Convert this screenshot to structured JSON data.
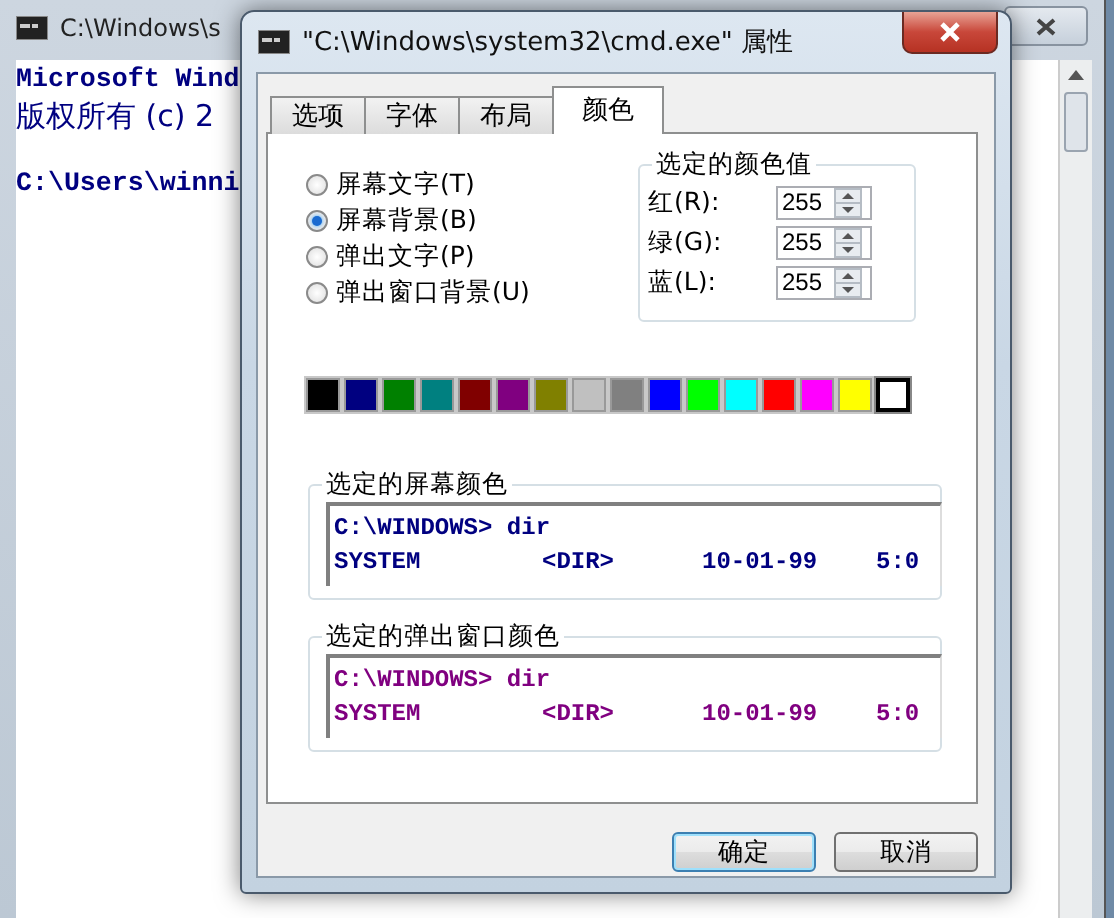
{
  "console_window": {
    "title": "C:\\Windows\\s",
    "paragraphs": [
      [
        "Microsoft Wind",
        "版权所有 (c) 2"
      ],
      [
        "C:\\Users\\winni"
      ]
    ]
  },
  "dialog": {
    "title": "\"C:\\Windows\\system32\\cmd.exe\" 属性",
    "tabs": [
      {
        "label": "选项",
        "selected": false
      },
      {
        "label": "字体",
        "selected": false
      },
      {
        "label": "布局",
        "selected": false
      },
      {
        "label": "颜色",
        "selected": true
      }
    ],
    "targets": [
      {
        "label": "屏幕文字(T)",
        "selected": false
      },
      {
        "label": "屏幕背景(B)",
        "selected": true
      },
      {
        "label": "弹出文字(P)",
        "selected": false
      },
      {
        "label": "弹出窗口背景(U)",
        "selected": false
      }
    ],
    "color_values": {
      "title": "选定的颜色值",
      "fields": [
        {
          "label": "红(R):",
          "value": "255"
        },
        {
          "label": "绿(G):",
          "value": "255"
        },
        {
          "label": "蓝(L):",
          "value": "255"
        }
      ]
    },
    "palette": [
      {
        "color": "#000000",
        "selected": false
      },
      {
        "color": "#000080",
        "selected": false
      },
      {
        "color": "#008000",
        "selected": false
      },
      {
        "color": "#008080",
        "selected": false
      },
      {
        "color": "#800000",
        "selected": false
      },
      {
        "color": "#800080",
        "selected": false
      },
      {
        "color": "#808000",
        "selected": false
      },
      {
        "color": "#c0c0c0",
        "selected": false
      },
      {
        "color": "#808080",
        "selected": false
      },
      {
        "color": "#0000ff",
        "selected": false
      },
      {
        "color": "#00ff00",
        "selected": false
      },
      {
        "color": "#00ffff",
        "selected": false
      },
      {
        "color": "#ff0000",
        "selected": false
      },
      {
        "color": "#ff00ff",
        "selected": false
      },
      {
        "color": "#ffff00",
        "selected": false
      },
      {
        "color": "#ffffff",
        "selected": true
      }
    ],
    "previews": [
      {
        "title": "选定的屏幕颜色",
        "color": "#000080",
        "lines": [
          [
            "C:\\WINDOWS> dir"
          ],
          [
            "SYSTEM",
            "<DIR>",
            "10-01-99",
            "5:0"
          ]
        ]
      },
      {
        "title": "选定的弹出窗口颜色",
        "color": "#800080",
        "lines": [
          [
            "C:\\WINDOWS> dir"
          ],
          [
            "SYSTEM",
            "<DIR>",
            "10-01-99",
            "5:0"
          ]
        ]
      }
    ],
    "buttons": [
      {
        "label": "确定",
        "default": true
      },
      {
        "label": "取消",
        "default": false
      }
    ]
  }
}
